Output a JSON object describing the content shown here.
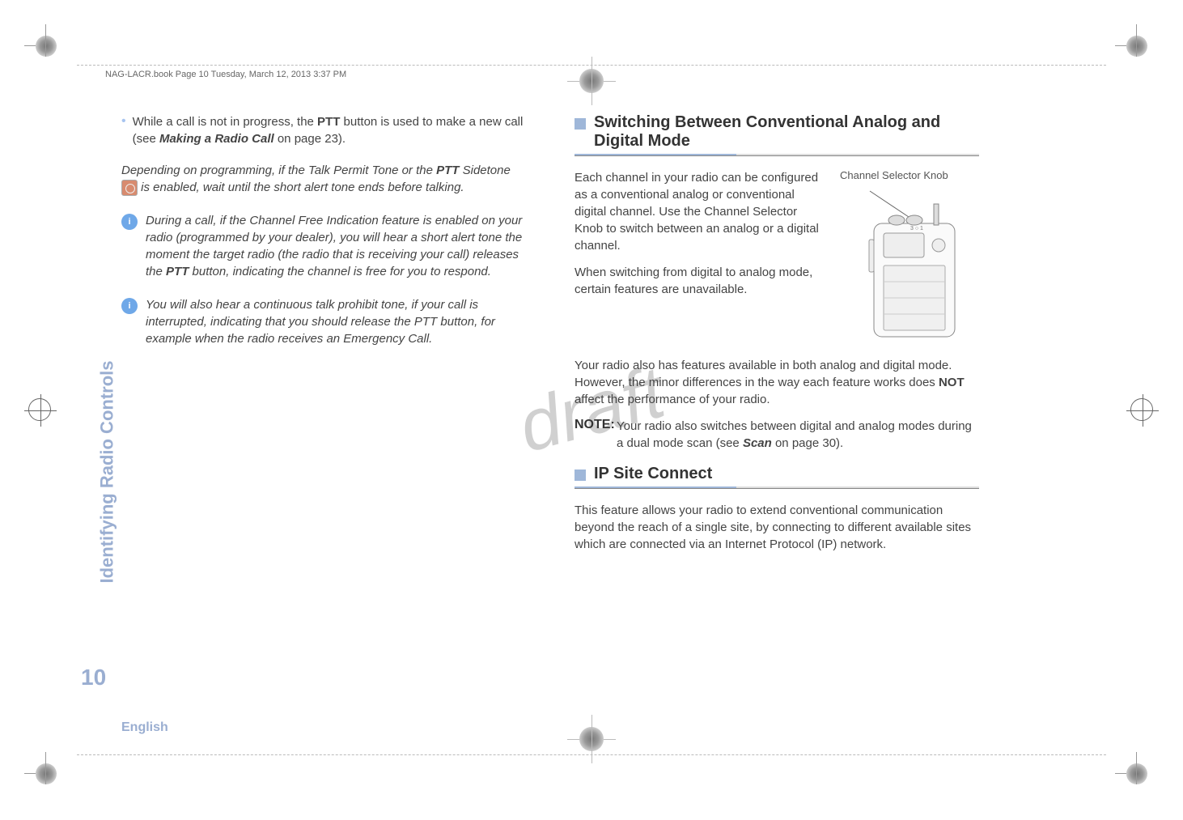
{
  "header": {
    "book_line": "NAG-LACR.book  Page 10  Tuesday, March 12, 2013  3:37 PM"
  },
  "watermark": "draft",
  "side_tab": "Identifying Radio Controls",
  "page_number": "10",
  "footer_lang": "English",
  "left": {
    "bullet1_pre": "While a call is not in progress, the ",
    "bullet1_bold": "PTT",
    "bullet1_mid": " button is used to make a new call (see ",
    "bullet1_link": "Making a Radio Call",
    "bullet1_post": " on page 23).",
    "para2_pre": "Depending on programming, if the Talk Permit Tone or the ",
    "para2_bold": "PTT",
    "para2_mid": " Sidetone ",
    "para2_post": " is enabled, wait until the short alert tone ends before talking.",
    "note1_pre": "During a call, if the Channel Free Indication feature is enabled on your radio (programmed by your dealer), you will hear a short alert tone the moment the target radio (the radio that is receiving your call) releases the ",
    "note1_bold": "PTT",
    "note1_post": " button, indicating the channel is free for you to respond.",
    "note2": "You will also hear a continuous talk prohibit tone, if your call is interrupted, indicating that you should release the PTT button, for example when the radio receives an Emergency Call."
  },
  "right": {
    "section1_title": "Switching Between Conventional Analog and Digital Mode",
    "fig_caption": "Channel Selector Knob",
    "para1": "Each channel in your radio can be configured as a conventional analog or conventional digital channel. Use the Channel Selector Knob to switch between an analog or a digital channel.",
    "para2": "When switching from digital to analog mode, certain features are unavailable.",
    "para3_pre": "Your radio also has features available in both analog and digital mode. However, the minor differences in the way each feature works does ",
    "para3_bold": "NOT",
    "para3_post": " affect the performance of your radio.",
    "note_label": "NOTE:",
    "note_pre": "Your radio also switches between digital and analog modes during a dual mode scan (see ",
    "note_link": "Scan",
    "note_post": " on page 30).",
    "section2_title": "IP Site Connect",
    "para4": "This feature allows your radio to extend conventional communication beyond the reach of a single site, by connecting to different available sites which are connected via an Internet Protocol (IP) network."
  }
}
